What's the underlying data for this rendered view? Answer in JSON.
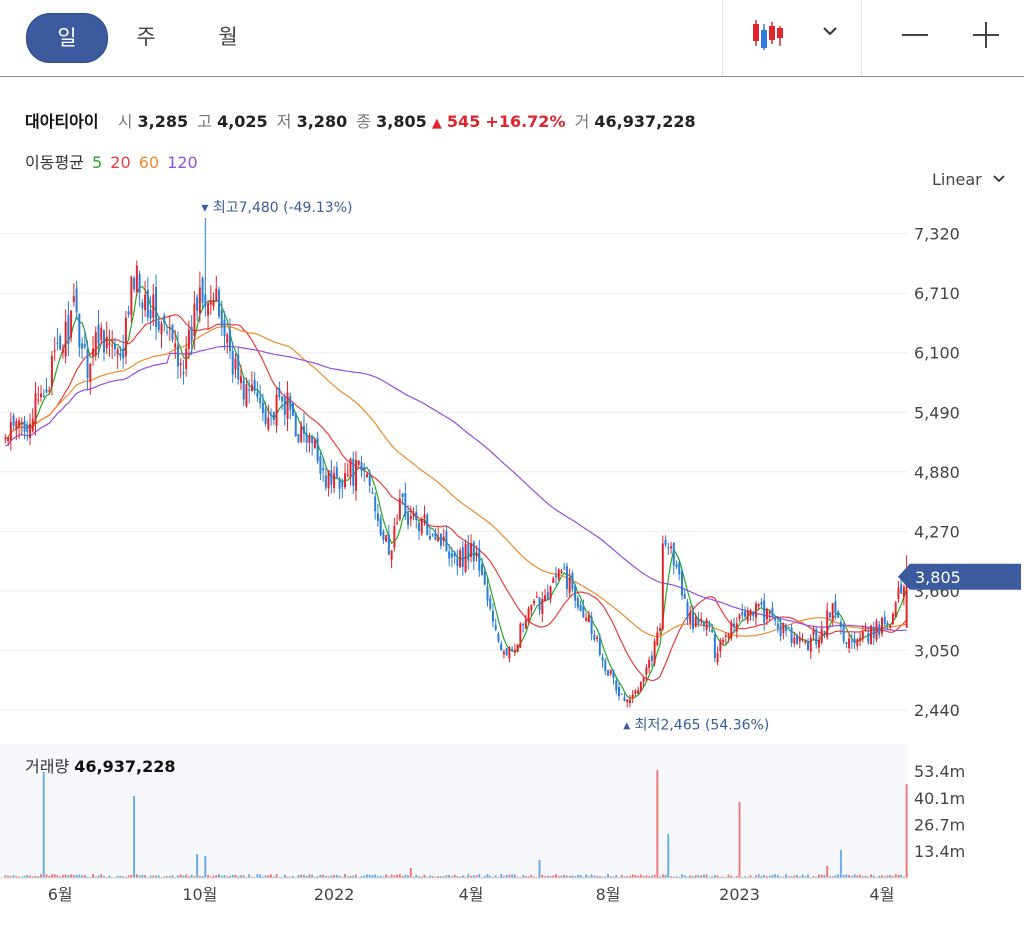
{
  "toolbar": {
    "periods": [
      "일",
      "주",
      "월"
    ],
    "active_period": "일",
    "candle_icon": "candlestick-icon",
    "dropdown_icon": "chevron-down-icon",
    "zoom_out_icon": "minus-icon",
    "zoom_in_icon": "plus-icon"
  },
  "quote": {
    "name": "대아티아이",
    "open_label": "시",
    "open": "3,285",
    "high_label": "고",
    "high": "4,025",
    "low_label": "저",
    "low": "3,280",
    "close_label": "종",
    "close": "3,805",
    "change_arrow": "▲",
    "change": "545",
    "change_pct": "+16.72%",
    "volume_label": "거",
    "volume": "46,937,228"
  },
  "moving_average": {
    "label": "이동평균",
    "periods": [
      {
        "label": "5",
        "color": "#26a826"
      },
      {
        "label": "20",
        "color": "#ee3b3b"
      },
      {
        "label": "60",
        "color": "#f28a2a"
      },
      {
        "label": "120",
        "color": "#9b4de0"
      }
    ]
  },
  "scale_mode": "Linear",
  "colors": {
    "up": "#e0252c",
    "down": "#2a7ed8",
    "accent": "#3b5b9e"
  },
  "chart_data": {
    "type": "candlestick",
    "ylim": [
      2440,
      7480
    ],
    "y_ticks": [
      "7,320",
      "6,710",
      "6,100",
      "5,490",
      "4,880",
      "4,270",
      "3,660",
      "3,050",
      "2,440"
    ],
    "y_tick_values": [
      7320,
      6710,
      6100,
      5490,
      4880,
      4270,
      3660,
      3050,
      2440
    ],
    "x_ticks": [
      "6월",
      "10월",
      "2022",
      "4월",
      "8월",
      "2023",
      "4월"
    ],
    "x_tick_index": [
      20,
      71,
      120,
      170,
      220,
      268,
      320
    ],
    "num_bars": 330,
    "price_anchors": [
      [
        0,
        5200
      ],
      [
        12,
        5550
      ],
      [
        20,
        6150
      ],
      [
        25,
        6500
      ],
      [
        30,
        6000
      ],
      [
        35,
        6350
      ],
      [
        42,
        5950
      ],
      [
        47,
        6900
      ],
      [
        52,
        6650
      ],
      [
        56,
        6400
      ],
      [
        62,
        6150
      ],
      [
        66,
        6000
      ],
      [
        71,
        6800
      ],
      [
        74,
        6750
      ],
      [
        78,
        6500
      ],
      [
        82,
        6150
      ],
      [
        86,
        5750
      ],
      [
        92,
        5650
      ],
      [
        97,
        5450
      ],
      [
        102,
        5600
      ],
      [
        108,
        5250
      ],
      [
        113,
        5100
      ],
      [
        118,
        4780
      ],
      [
        126,
        4880
      ],
      [
        132,
        4850
      ],
      [
        136,
        4450
      ],
      [
        140,
        4000
      ],
      [
        144,
        4550
      ],
      [
        150,
        4350
      ],
      [
        156,
        4300
      ],
      [
        160,
        4150
      ],
      [
        166,
        4000
      ],
      [
        170,
        4100
      ],
      [
        174,
        3850
      ],
      [
        178,
        3300
      ],
      [
        183,
        2950
      ],
      [
        188,
        3250
      ],
      [
        192,
        3450
      ],
      [
        196,
        3600
      ],
      [
        200,
        3750
      ],
      [
        204,
        3850
      ],
      [
        208,
        3600
      ],
      [
        212,
        3450
      ],
      [
        216,
        3150
      ],
      [
        220,
        2850
      ],
      [
        224,
        2600
      ],
      [
        228,
        2500
      ],
      [
        232,
        2800
      ],
      [
        236,
        3000
      ],
      [
        239,
        3300
      ],
      [
        240,
        4250
      ],
      [
        244,
        4000
      ],
      [
        248,
        3500
      ],
      [
        252,
        3300
      ],
      [
        256,
        3350
      ],
      [
        259,
        3050
      ],
      [
        262,
        3200
      ],
      [
        266,
        3350
      ],
      [
        270,
        3450
      ],
      [
        274,
        3500
      ],
      [
        278,
        3400
      ],
      [
        282,
        3300
      ],
      [
        286,
        3200
      ],
      [
        290,
        3100
      ],
      [
        294,
        3150
      ],
      [
        298,
        3250
      ],
      [
        302,
        3500
      ],
      [
        306,
        3200
      ],
      [
        310,
        3100
      ],
      [
        315,
        3200
      ],
      [
        319,
        3280
      ],
      [
        323,
        3400
      ],
      [
        329,
        3805
      ]
    ],
    "high": {
      "value": 7480,
      "label": "최고",
      "text": "7,480 (-49.13%)",
      "index": 73
    },
    "low": {
      "value": 2465,
      "label": "최저",
      "text": "2,465 (54.36%)",
      "index": 227
    },
    "last": {
      "value": 3805,
      "label": "3,805"
    },
    "ma_periods": [
      5,
      20,
      60,
      120
    ],
    "volume": {
      "title": "거래량",
      "value": "46,937,228",
      "y_ticks": [
        "53.4m",
        "40.1m",
        "26.7m",
        "13.4m"
      ],
      "y_tick_values": [
        53.4,
        40.1,
        26.7,
        13.4
      ],
      "ylim": [
        0,
        67
      ],
      "spikes": [
        [
          14,
          53
        ],
        [
          47,
          41
        ],
        [
          70,
          12
        ],
        [
          73,
          11
        ],
        [
          148,
          5
        ],
        [
          195,
          9
        ],
        [
          238,
          54
        ],
        [
          242,
          22
        ],
        [
          268,
          38
        ],
        [
          300,
          6
        ],
        [
          305,
          14
        ],
        [
          329,
          46.9
        ]
      ]
    }
  }
}
